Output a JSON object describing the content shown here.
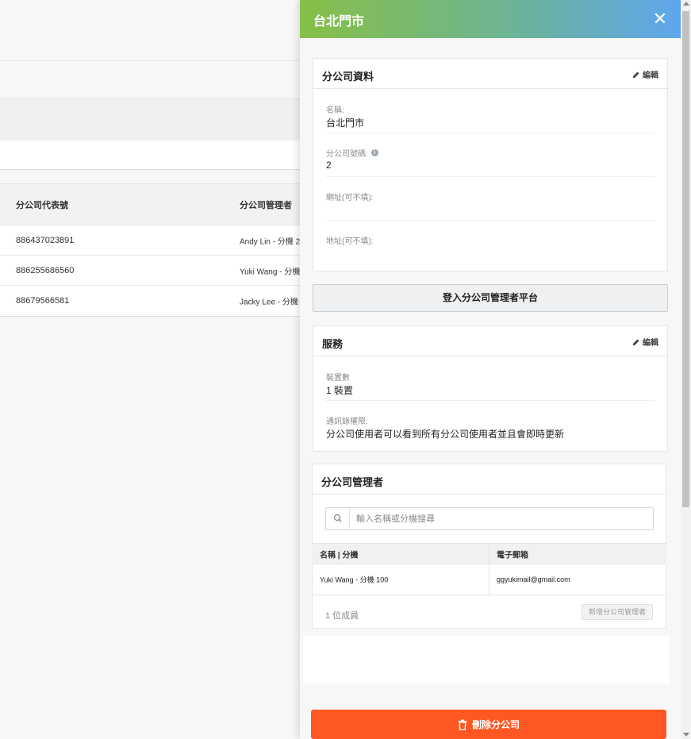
{
  "background": {
    "table": {
      "columns": [
        "分公司代表號",
        "分公司管理者"
      ],
      "rows": [
        {
          "number": "886437023891",
          "manager": "Andy Lin - 分機 2"
        },
        {
          "number": "886255686560",
          "manager": "Yuki Wang - 分機"
        },
        {
          "number": "88679566581",
          "manager": "Jacky Lee - 分機"
        }
      ]
    }
  },
  "drawer": {
    "title": "台北門市",
    "close_glyph": "✕",
    "branch_info": {
      "title": "分公司資料",
      "edit_label": "編輯",
      "fields": [
        {
          "label": "名稱:",
          "value": "台北門市"
        },
        {
          "label": "分公司號碼:",
          "value": "2"
        },
        {
          "label": "網址(可不填):",
          "value": ""
        },
        {
          "label": "地址(可不填):",
          "value": ""
        }
      ]
    },
    "login_button": "登入分公司管理者平台",
    "service": {
      "title": "服務",
      "edit_label": "編輯",
      "fields": [
        {
          "label": "裝置數",
          "value": "1 裝置"
        },
        {
          "label": "通訊錄權限:",
          "value": "分公司使用者可以看到所有分公司使用者並且會即時更新"
        }
      ]
    },
    "managers": {
      "title": "分公司管理者",
      "search_placeholder": "輸入名稱或分機搜尋",
      "columns": [
        "名稱 | 分機",
        "電子郵箱"
      ],
      "rows": [
        {
          "name": "Yuki Wang - 分機 100",
          "email": "ggyukimail@gmail.com"
        }
      ],
      "member_count": "1 位成員",
      "add_button": "新增分公司管理者"
    },
    "delete_button": "刪除分公司"
  },
  "colors": {
    "header_gradient_start": "#86c047",
    "header_gradient_end": "#5ea6ee",
    "delete": "#ff5722"
  }
}
